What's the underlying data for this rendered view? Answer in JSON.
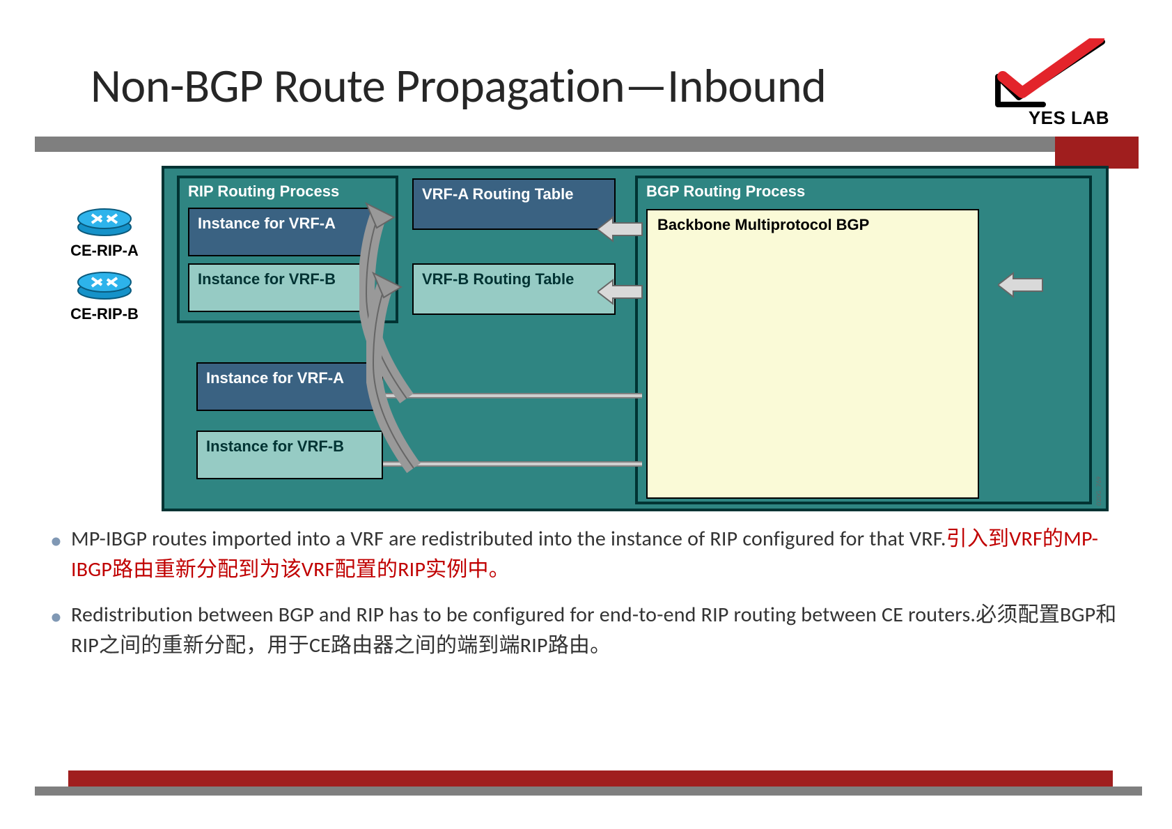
{
  "title": "Non-BGP Route Propagation—Inbound",
  "logo_text": "YES LAB",
  "routers": {
    "a": "CE-RIP-A",
    "b": "CE-RIP-B"
  },
  "diagram": {
    "rip_process": "RIP Routing Process",
    "inst_vrf_a": "Instance for VRF-A",
    "inst_vrf_b": "Instance for VRF-B",
    "rtable_a": "VRF-A Routing Table",
    "rtable_b": "VRF-B Routing Table",
    "bgp_process": "BGP Routing Process",
    "bgp_inner": "Backbone Multiprotocol BGP",
    "bot_inst_a": "Instance for VRF-A",
    "bot_inst_b": "Instance for VRF-B",
    "code": "020G_769"
  },
  "bullets": {
    "b1_en": "MP-IBGP routes imported into a VRF are redistributed into the instance  of RIP configured for that VRF.",
    "b1_cn": "引入到VRF的MP-IBGP路由重新分配到为该VRF配置的RIP实例中。",
    "b2_en": "Redistribution between BGP and RIP has to be configured for end-to-end RIP routing between CE routers.",
    "b2_cn": "必须配置BGP和RIP之间的重新分配，用于CE路由器之间的端到端RIP路由。"
  }
}
